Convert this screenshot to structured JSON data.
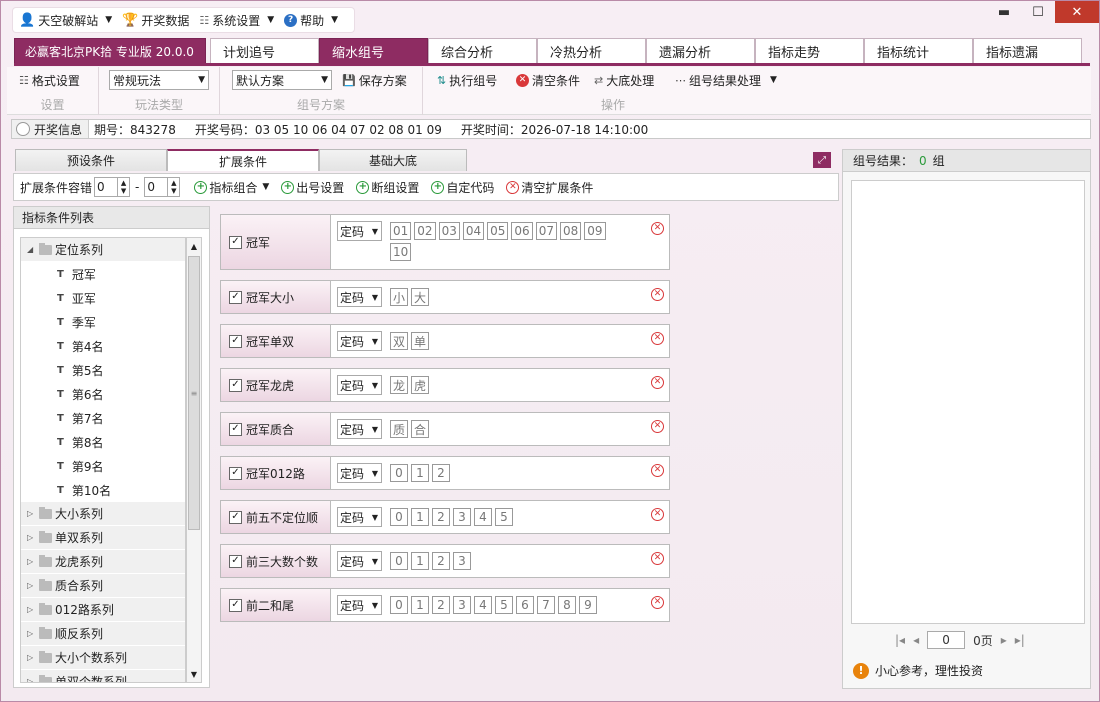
{
  "menu": [
    {
      "label": "天空破解站",
      "icon": "user-icon",
      "caret": true
    },
    {
      "label": "开奖数据",
      "icon": "trophy-icon",
      "caret": false
    },
    {
      "label": "系统设置",
      "icon": "sliders-icon",
      "caret": true
    },
    {
      "label": "帮助",
      "icon": "help-icon",
      "caret": true
    }
  ],
  "window": {
    "minimize": "▬",
    "maximize": "☐",
    "close": "✕"
  },
  "tabs": {
    "app": "必赢客北京PK拾 专业版 20.0.0",
    "items": [
      "计划追号",
      "缩水组号",
      "综合分析",
      "冷热分析",
      "遗漏分析",
      "指标走势",
      "指标统计",
      "指标遗漏"
    ],
    "active_index": 1
  },
  "toolbar": {
    "format_label": "格式设置",
    "setting_caption": "设置",
    "play_select": "常规玩法",
    "play_caption": "玩法类型",
    "scheme_select": "默认方案",
    "save_scheme": "保存方案",
    "scheme_caption": "组号方案",
    "execute": "执行组号",
    "clear": "清空条件",
    "big_filter": "大底处理",
    "result_process": "组号结果处理",
    "op_caption": "操作"
  },
  "info": {
    "label": "开奖信息",
    "period": "期号：843278",
    "numbers": "开奖号码：03 05 10 06 04 07 02 08 01 09",
    "time": "开奖时间：2026-07-18 14:10:00"
  },
  "subtabs": [
    "预设条件",
    "扩展条件",
    "基础大底"
  ],
  "condbar": {
    "tolerance_label": "扩展条件容错",
    "from": "0",
    "dash": "-",
    "to": "0",
    "buttons": [
      {
        "label": "指标组合",
        "type": "plus",
        "caret": true
      },
      {
        "label": "出号设置",
        "type": "plus",
        "caret": false
      },
      {
        "label": "断组设置",
        "type": "plus",
        "caret": false
      },
      {
        "label": "自定代码",
        "type": "plus",
        "caret": false
      },
      {
        "label": "清空扩展条件",
        "type": "x",
        "caret": false
      }
    ]
  },
  "tree": {
    "header": "指标条件列表",
    "nodes": [
      {
        "label": "定位系列",
        "type": "parent",
        "open": true
      },
      {
        "label": "冠军",
        "type": "child"
      },
      {
        "label": "亚军",
        "type": "child"
      },
      {
        "label": "季军",
        "type": "child"
      },
      {
        "label": "第4名",
        "type": "child"
      },
      {
        "label": "第5名",
        "type": "child"
      },
      {
        "label": "第6名",
        "type": "child"
      },
      {
        "label": "第7名",
        "type": "child"
      },
      {
        "label": "第8名",
        "type": "child"
      },
      {
        "label": "第9名",
        "type": "child"
      },
      {
        "label": "第10名",
        "type": "child"
      },
      {
        "label": "大小系列",
        "type": "parent",
        "open": false
      },
      {
        "label": "单双系列",
        "type": "parent",
        "open": false
      },
      {
        "label": "龙虎系列",
        "type": "parent",
        "open": false
      },
      {
        "label": "质合系列",
        "type": "parent",
        "open": false
      },
      {
        "label": "012路系列",
        "type": "parent",
        "open": false
      },
      {
        "label": "顺反系列",
        "type": "parent",
        "open": false
      },
      {
        "label": "大小个数系列",
        "type": "parent",
        "open": false
      },
      {
        "label": "单双个数系列",
        "type": "parent",
        "open": false
      }
    ]
  },
  "conditions": [
    {
      "label": "冠军",
      "mode": "定码",
      "chips": [
        "01",
        "02",
        "03",
        "04",
        "05",
        "06",
        "07",
        "08",
        "09",
        "10"
      ],
      "checked": true
    },
    {
      "label": "冠军大小",
      "mode": "定码",
      "chips": [
        "小",
        "大"
      ],
      "checked": true
    },
    {
      "label": "冠军单双",
      "mode": "定码",
      "chips": [
        "双",
        "单"
      ],
      "checked": true
    },
    {
      "label": "冠军龙虎",
      "mode": "定码",
      "chips": [
        "龙",
        "虎"
      ],
      "checked": true
    },
    {
      "label": "冠军质合",
      "mode": "定码",
      "chips": [
        "质",
        "合"
      ],
      "checked": true
    },
    {
      "label": "冠军012路",
      "mode": "定码",
      "chips": [
        "0",
        "1",
        "2"
      ],
      "checked": true
    },
    {
      "label": "前五不定位顺",
      "mode": "定码",
      "chips": [
        "0",
        "1",
        "2",
        "3",
        "4",
        "5"
      ],
      "checked": true
    },
    {
      "label": "前三大数个数",
      "mode": "定码",
      "chips": [
        "0",
        "1",
        "2",
        "3"
      ],
      "checked": true
    },
    {
      "label": "前二和尾",
      "mode": "定码",
      "chips": [
        "0",
        "1",
        "2",
        "3",
        "4",
        "5",
        "6",
        "7",
        "8",
        "9"
      ],
      "checked": true
    }
  ],
  "result": {
    "label": "组号结果：",
    "count": "0",
    "unit": "组",
    "page_input": "0",
    "page_label": "0页",
    "warning": "小心参考，理性投资"
  }
}
